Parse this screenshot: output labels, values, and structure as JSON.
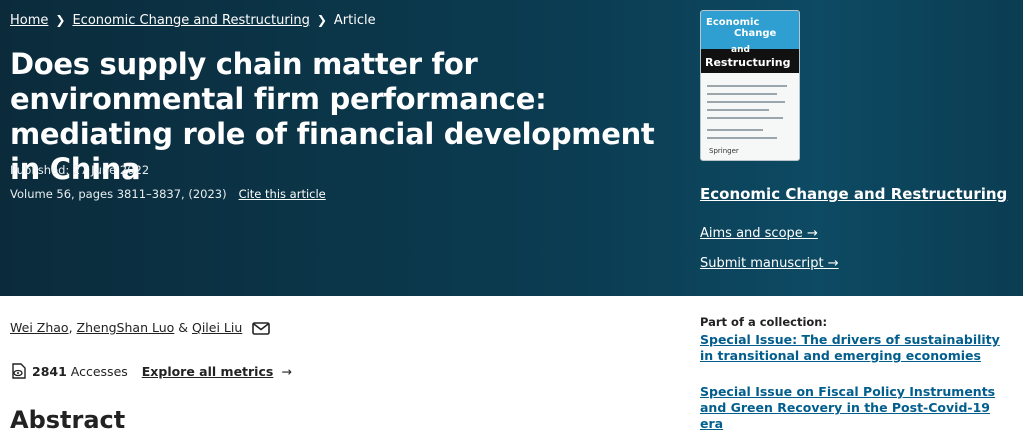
{
  "breadcrumbs": [
    {
      "label": "Home"
    },
    {
      "label": "Economic Change and Restructuring"
    },
    {
      "label": "Article"
    }
  ],
  "article": {
    "title": "Does supply chain matter for environmental firm performance: mediating role of financial development in China",
    "published": "Published: 27 June 2022",
    "volume": "Volume 56, pages 3811–3837, (2023)",
    "cite_label": "Cite this article"
  },
  "cover": {
    "title_lines": [
      "Economic",
      "Change",
      "and",
      "Restructuring"
    ],
    "publisher": "Springer"
  },
  "sidebar": {
    "journal_title": "Economic Change and Restructuring",
    "links": [
      {
        "label": "Aims and scope",
        "icon": "arrow-right-icon"
      },
      {
        "label": "Submit manuscript",
        "icon": "arrow-right-icon"
      }
    ],
    "collection_heading": "Part of a collection:",
    "collections": [
      {
        "label": "Special Issue: The drivers of sustainability in transitional and emerging economies"
      },
      {
        "label": "Special Issue on Fiscal Policy Instruments and Green Recovery in the Post-Covid-19 era"
      }
    ]
  },
  "authors": [
    {
      "name": "Wei Zhao"
    },
    {
      "name": "ZhengShan Luo"
    },
    {
      "name": "Qilei Liu"
    }
  ],
  "metrics": {
    "accesses_count": "2841",
    "accesses_label": "Accesses",
    "explore_label": "Explore all metrics"
  },
  "abstract_heading": "Abstract",
  "colors": {
    "hero_bg": "#0b3c51",
    "link_blue": "#025e8d",
    "cover_accent": "#2e9fd0"
  }
}
